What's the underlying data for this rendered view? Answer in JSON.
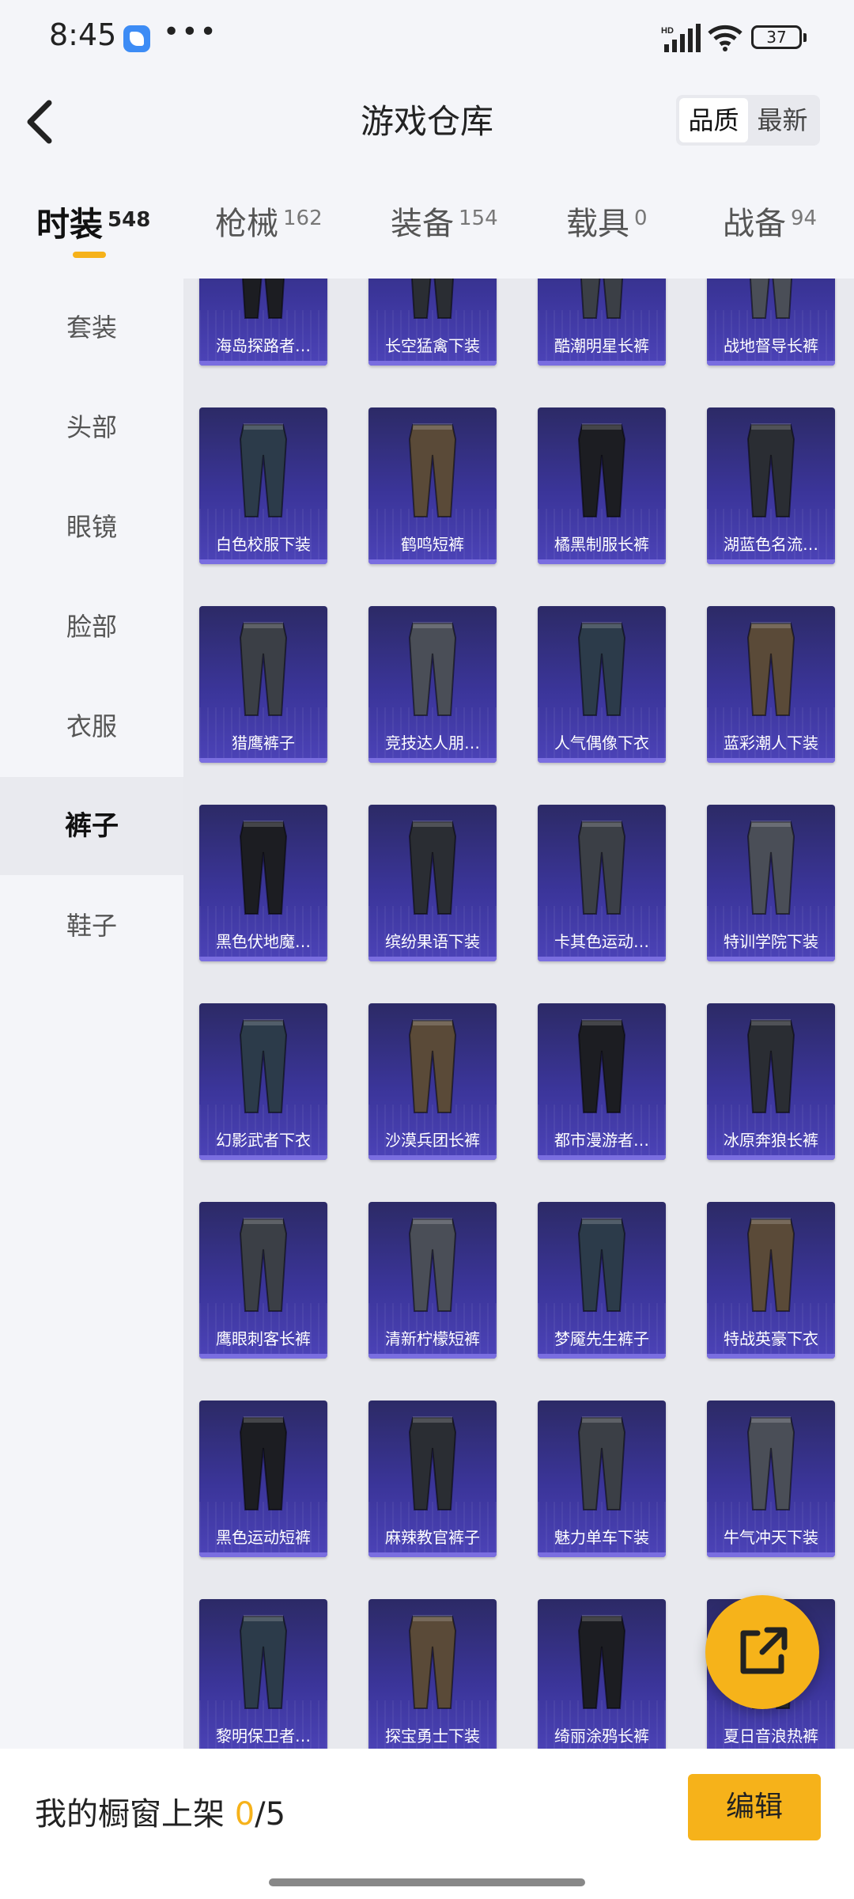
{
  "status_bar": {
    "time": "8:45",
    "battery": "37",
    "network": "HD"
  },
  "header": {
    "title": "游戏仓库",
    "sort_options": [
      {
        "label": "品质",
        "active": true
      },
      {
        "label": "最新",
        "active": false
      }
    ]
  },
  "tabs": [
    {
      "label": "时装",
      "count": "548",
      "active": true
    },
    {
      "label": "枪械",
      "count": "162",
      "active": false
    },
    {
      "label": "装备",
      "count": "154",
      "active": false
    },
    {
      "label": "载具",
      "count": "0",
      "active": false
    },
    {
      "label": "战备",
      "count": "94",
      "active": false
    }
  ],
  "sidebar": {
    "items": [
      {
        "label": "套装",
        "active": false
      },
      {
        "label": "头部",
        "active": false
      },
      {
        "label": "眼镜",
        "active": false
      },
      {
        "label": "脸部",
        "active": false
      },
      {
        "label": "衣服",
        "active": false
      },
      {
        "label": "裤子",
        "active": true
      },
      {
        "label": "鞋子",
        "active": false
      }
    ]
  },
  "items": [
    "海岛探路者…",
    "长空猛禽下装",
    "酷潮明星长裤",
    "战地督导长裤",
    "白色校服下装",
    "鹤鸣短裤",
    "橘黑制服长裤",
    "湖蓝色名流…",
    "猎鹰裤子",
    "竞技达人朋…",
    "人气偶像下衣",
    "蓝彩潮人下装",
    "黑色伏地魔…",
    "缤纷果语下装",
    "卡其色运动…",
    "特训学院下装",
    "幻影武者下衣",
    "沙漠兵团长裤",
    "都市漫游者…",
    "冰原奔狼长裤",
    "鹰眼刺客长裤",
    "清新柠檬短裤",
    "梦魇先生裤子",
    "特战英豪下衣",
    "黑色运动短裤",
    "麻辣教官裤子",
    "魅力单车下装",
    "牛气冲天下装",
    "黎明保卫者…",
    "探宝勇士下装",
    "绮丽涂鸦长裤",
    "夏日音浪热裤"
  ],
  "showcase": {
    "label": "我的橱窗上架",
    "current": "0",
    "max": "/5",
    "edit_label": "编辑"
  },
  "colors": {
    "accent": "#f6b21a",
    "card_bg": "#3b359a",
    "card_strip": "#7a6ee0"
  },
  "icons": {
    "back": "chevron-left-icon",
    "share": "share-icon"
  }
}
